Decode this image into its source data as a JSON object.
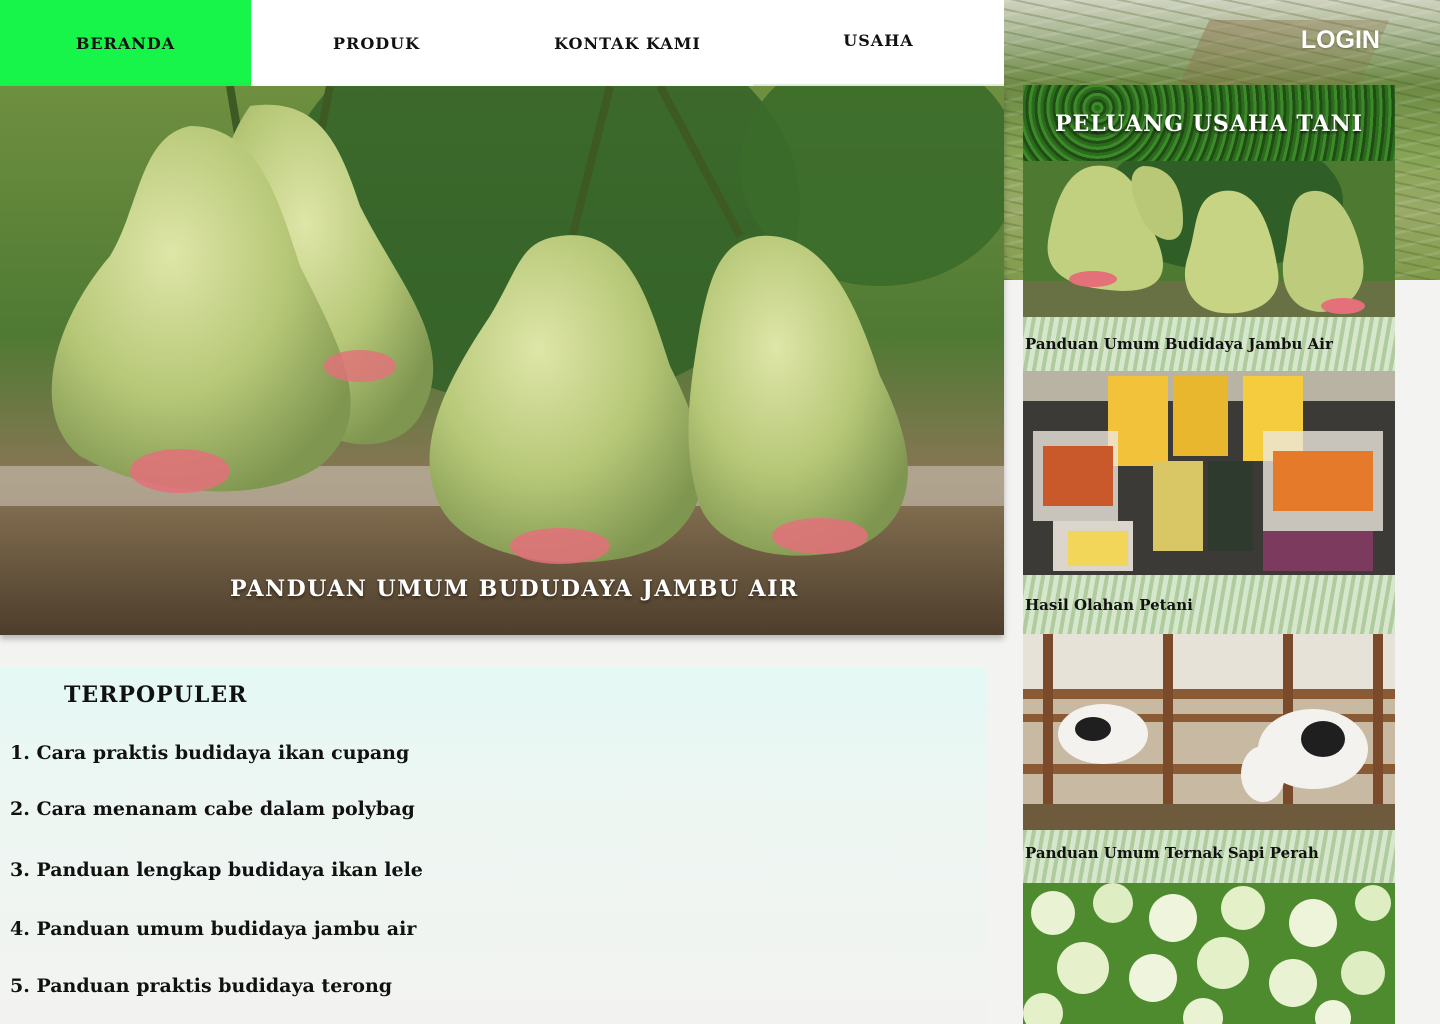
{
  "nav": {
    "items": [
      {
        "label": "BERANDA",
        "active": true
      },
      {
        "label": "PRODUK",
        "active": false
      },
      {
        "label": "KONTAK KAMI",
        "active": false
      },
      {
        "label": "USAHA",
        "active": false
      }
    ],
    "active_color": "#17f54b"
  },
  "header": {
    "login_label": "LOGIN"
  },
  "hero": {
    "caption": "PANDUAN UMUM BUDUDAYA JAMBU AIR"
  },
  "popular": {
    "title": "TERPOPULER",
    "items": [
      "1. Cara praktis budidaya ikan cupang",
      "2. Cara menanam cabe dalam polybag",
      "3. Panduan lengkap budidaya ikan lele",
      "4. Panduan umum budidaya jambu air",
      "5. Panduan praktis budidaya terong"
    ]
  },
  "sidebar": {
    "title": "PELUANG USAHA TANI",
    "cards": [
      {
        "label": "Panduan Umum Budidaya Jambu Air",
        "image": "jambu-air-image"
      },
      {
        "label": "Hasil Olahan Petani",
        "image": "snack-products-image"
      },
      {
        "label": "Panduan Umum Ternak Sapi Perah",
        "image": "dairy-cows-image"
      },
      {
        "label": "",
        "image": "flower-bush-image"
      }
    ]
  }
}
